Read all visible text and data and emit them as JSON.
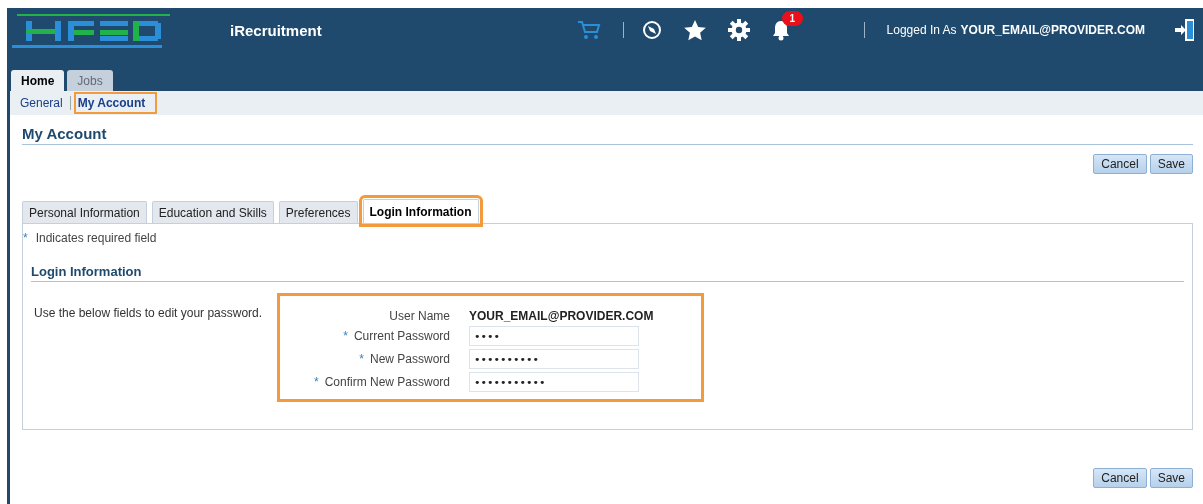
{
  "header": {
    "app_title": "iRecruitment",
    "notification_count": "1",
    "logged_in_label": "Logged In As",
    "user": "YOUR_EMAIL@PROVIDER.COM"
  },
  "tabs": [
    {
      "label": "Home",
      "selected": true
    },
    {
      "label": "Jobs",
      "selected": false
    }
  ],
  "subtabs": [
    {
      "label": "General",
      "selected": false,
      "highlighted": false
    },
    {
      "label": "My Account",
      "selected": true,
      "highlighted": true
    }
  ],
  "page_title": "My Account",
  "buttons_top": [
    "Cancel",
    "Save"
  ],
  "form_tabs": [
    {
      "label": "Personal Information",
      "selected": false,
      "highlighted": false
    },
    {
      "label": "Education and Skills",
      "selected": false,
      "highlighted": false
    },
    {
      "label": "Preferences",
      "selected": false,
      "highlighted": false
    },
    {
      "label": "Login Information",
      "selected": true,
      "highlighted": true
    }
  ],
  "required_note": {
    "mark": "*",
    "text": "Indicates required field"
  },
  "section": {
    "title": "Login Information",
    "instructions": "Use the below fields to edit your password.",
    "highlighted": true,
    "fields": [
      {
        "label": "User Name",
        "kind": "text",
        "required": false,
        "value": "YOUR_EMAIL@PROVIDER.COM"
      },
      {
        "label": "Current Password",
        "kind": "input",
        "required": true,
        "value": "••••"
      },
      {
        "label": "New Password",
        "kind": "input",
        "required": true,
        "value": "••••••••••"
      },
      {
        "label": "Confirm New Password",
        "kind": "input",
        "required": true,
        "value": "•••••••••••"
      }
    ]
  },
  "buttons_bottom": [
    "Cancel",
    "Save"
  ]
}
